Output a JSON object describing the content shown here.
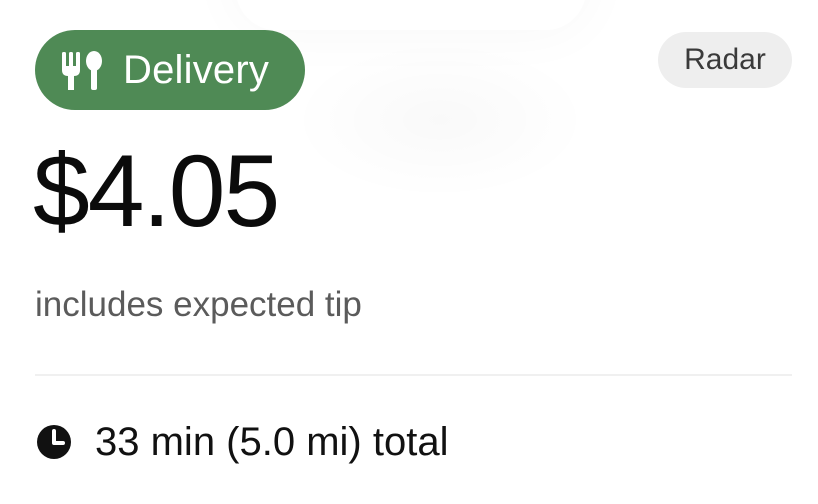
{
  "trip_card": {
    "badge": {
      "label": "Delivery",
      "icon": "fork-knife-icon",
      "color": "#4f8a55"
    },
    "radar_button": {
      "label": "Radar"
    },
    "fare": {
      "amount": "$4.05",
      "note": "includes expected tip"
    },
    "trip_summary": {
      "icon": "clock-icon",
      "text": "33 min (5.0 mi) total"
    }
  }
}
